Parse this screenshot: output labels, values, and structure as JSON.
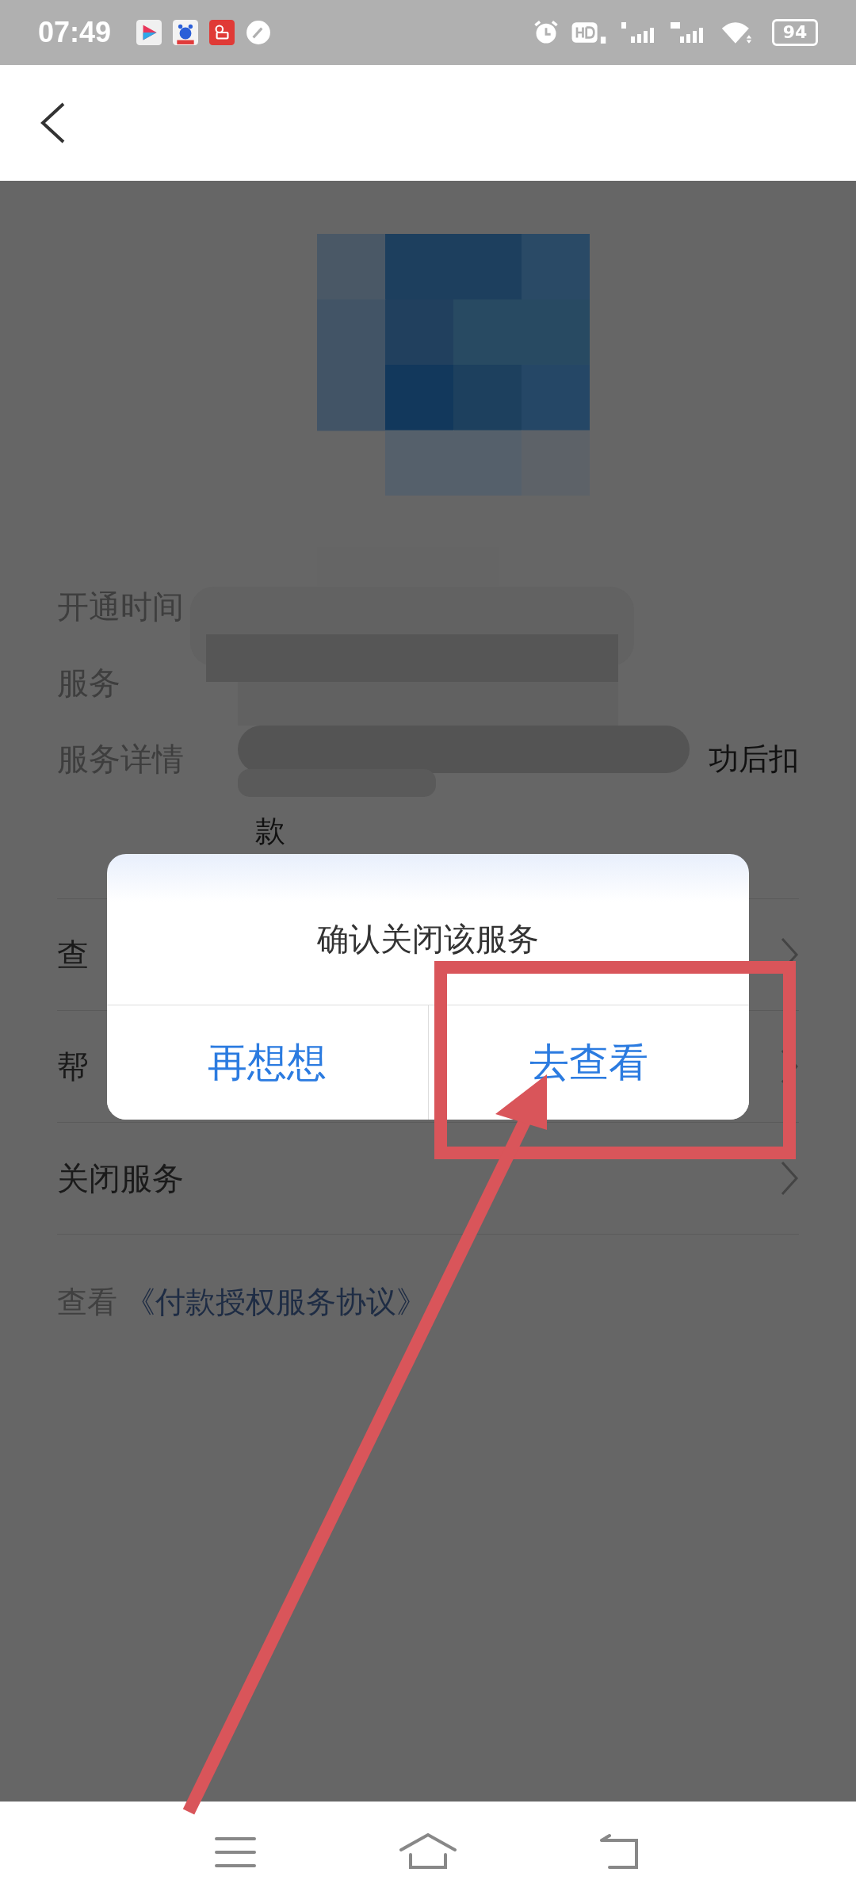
{
  "status_bar": {
    "time": "07:49",
    "battery": "94"
  },
  "details": [
    {
      "label": "开通时间"
    },
    {
      "label": "服务"
    },
    {
      "label": "服务详情",
      "value_lines": [
        "功后扣",
        "款"
      ]
    }
  ],
  "menu": [
    {
      "label": "查"
    },
    {
      "label": "帮"
    },
    {
      "label": "关闭服务"
    }
  ],
  "agreement": {
    "prefix": "查看",
    "link": "《付款授权服务协议》"
  },
  "dialog": {
    "title": "确认关闭该服务",
    "buttons": [
      {
        "label": "再想想"
      },
      {
        "label": "去查看"
      }
    ]
  },
  "annotation": {
    "frame_shown": true,
    "arrow_shown": true
  }
}
